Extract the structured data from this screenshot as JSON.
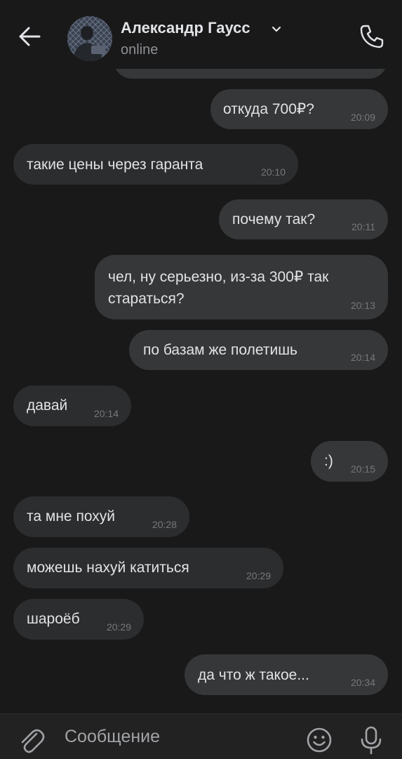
{
  "header": {
    "contact_name": "Александр Гаусс",
    "status": "online",
    "icons": {
      "back": "arrow-left-icon",
      "dropdown": "chevron-down-icon",
      "call": "phone-icon"
    }
  },
  "messages": [
    {
      "direction": "outgoing",
      "text": "откуда 700₽?",
      "time": "20:09"
    },
    {
      "direction": "incoming",
      "text": "такие цены через гаранта",
      "time": "20:10"
    },
    {
      "direction": "outgoing",
      "text": "почему так?",
      "time": "20:11"
    },
    {
      "direction": "outgoing",
      "text": "чел, ну серьезно, из-за 300₽ так стараться?",
      "line1": "чел, ну серьезно, из-за 300₽ так",
      "line2": "стараться?",
      "time": "20:13"
    },
    {
      "direction": "outgoing",
      "text": "по базам же полетишь",
      "time": "20:14"
    },
    {
      "direction": "incoming",
      "text": "давай",
      "time": "20:14"
    },
    {
      "direction": "outgoing",
      "text": ":)",
      "time": "20:15"
    },
    {
      "direction": "incoming",
      "text": "та мне похуй",
      "time": "20:28"
    },
    {
      "direction": "incoming",
      "text": "можешь нахуй катиться",
      "time": "20:29"
    },
    {
      "direction": "incoming",
      "text": "шароёб",
      "time": "20:29"
    },
    {
      "direction": "outgoing",
      "text": "да что ж такое...",
      "time": "20:34"
    }
  ],
  "composer": {
    "placeholder": "Сообщение",
    "icons": {
      "attach": "paperclip-icon",
      "emoji": "emoji-icon",
      "voice": "microphone-icon"
    }
  },
  "colors": {
    "background": "#19191a",
    "incoming_bubble": "#2c2d2e",
    "outgoing_bubble": "#363738",
    "text": "#e1e3e6",
    "secondary_text": "#8d9095",
    "composer_background": "#222222"
  }
}
